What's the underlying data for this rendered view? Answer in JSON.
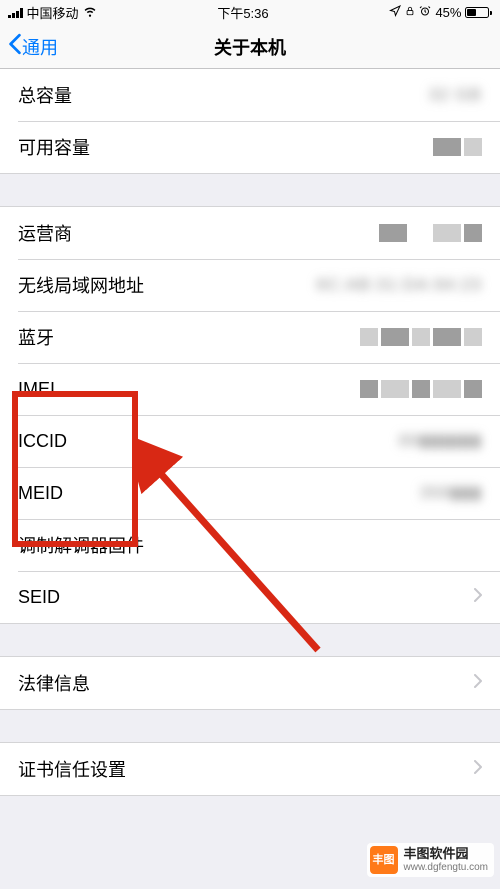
{
  "status": {
    "carrier": "中国移动",
    "time": "下午5:36",
    "battery_pct": "45%"
  },
  "nav": {
    "back_label": "通用",
    "title": "关于本机"
  },
  "group1": {
    "total_capacity": {
      "label": "总容量",
      "value": "32 GB"
    },
    "available": {
      "label": "可用容量",
      "value": "▮▮"
    }
  },
  "group2": {
    "carrier": {
      "label": "运营商",
      "value": "▮▮  ▮▮"
    },
    "wifi_addr": {
      "label": "无线局域网地址",
      "value": "6C:AB:31:DA:94:23"
    },
    "bluetooth": {
      "label": "蓝牙",
      "value": "▮▮▮▮"
    },
    "imei": {
      "label": "IMEI",
      "value": "▮▮▮▮▮"
    },
    "iccid": {
      "label": "ICCID",
      "value": "89▮▮▮▮▮▮"
    },
    "meid": {
      "label": "MEID",
      "value": "358▮▮▮"
    },
    "modem": {
      "label": "调制解调器固件",
      "value": ""
    },
    "seid": {
      "label": "SEID"
    }
  },
  "group3": {
    "legal": {
      "label": "法律信息"
    }
  },
  "group4": {
    "cert": {
      "label": "证书信任设置"
    }
  },
  "watermark": {
    "name": "丰图软件园",
    "url": "www.dgfengtu.com"
  }
}
